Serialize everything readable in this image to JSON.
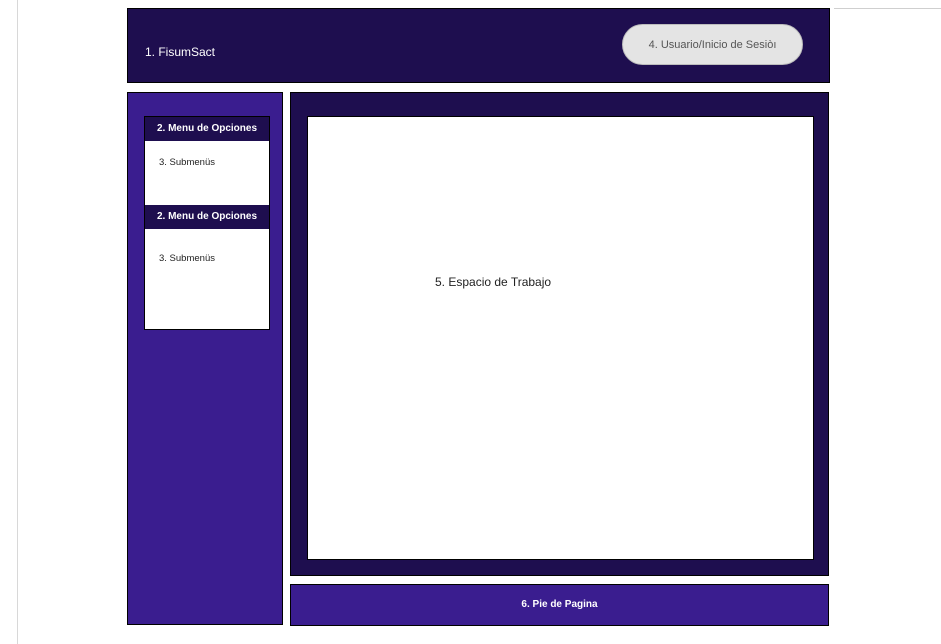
{
  "header": {
    "brand": "1. FisumSact",
    "user_button": "4. Usuario/Inicio de Sesiòı"
  },
  "sidebar": {
    "menus": [
      {
        "title": "2. Menu de Opciones",
        "submenu": "3. Submenüs"
      },
      {
        "title": "2. Menu de Opciones",
        "submenu": "3. Submenüs"
      }
    ]
  },
  "main": {
    "workspace_label": "5. Espacio de Trabajo"
  },
  "footer": {
    "label": "6. Pie de Pagina"
  },
  "colors": {
    "header_bg": "#1e0e4f",
    "sidebar_bg": "#3a1d8f",
    "pill_bg": "#e4e4e4"
  }
}
